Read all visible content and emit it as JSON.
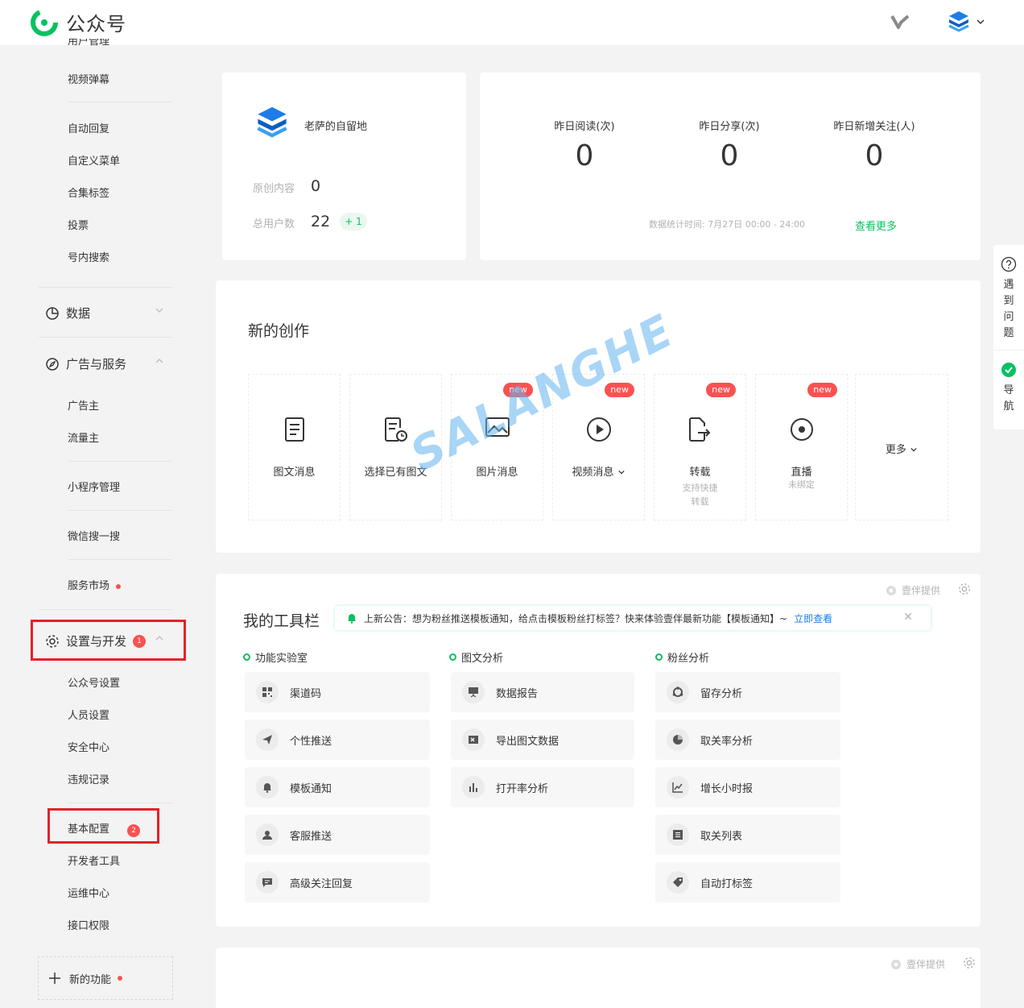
{
  "header": {
    "title": "公众号",
    "brand_color": "#07c160"
  },
  "sidebar": {
    "top_cut_item": "用户管理",
    "items_a": [
      "视频弹幕"
    ],
    "items_b": [
      "自动回复",
      "自定义菜单",
      "合集标签",
      "投票",
      "号内搜索"
    ],
    "group_data": "数据",
    "group_ads": "广告与服务",
    "ads_items": [
      "广告主",
      "流量主"
    ],
    "mini_program": "小程序管理",
    "wechat_search": "微信搜一搜",
    "service_market": "服务市场",
    "group_settings": "设置与开发",
    "settings_badge": "1",
    "settings_items": [
      "公众号设置",
      "人员设置",
      "安全中心",
      "违规记录"
    ],
    "basic_config": "基本配置",
    "basic_badge": "2",
    "dev_items": [
      "开发者工具",
      "运维中心",
      "接口权限"
    ],
    "new_features": "新的功能"
  },
  "account": {
    "name": "老萨的自留地",
    "original_label": "原创内容",
    "original_value": "0",
    "users_label": "总用户数",
    "users_value": "22",
    "users_delta": "+ 1"
  },
  "stats": {
    "items": [
      {
        "label": "昨日阅读(次)",
        "value": "0"
      },
      {
        "label": "昨日分享(次)",
        "value": "0"
      },
      {
        "label": "昨日新增关注(人)",
        "value": "0"
      }
    ],
    "footer": "数据统计时间: 7月27日 00:00 - 24:00",
    "more": "查看更多"
  },
  "creation": {
    "title": "新的创作",
    "new_tag": "new",
    "tiles": [
      {
        "label": "图文消息",
        "sub": "",
        "icon": "doc-icon"
      },
      {
        "label": "选择已有图文",
        "sub": "",
        "icon": "doc-clock-icon"
      },
      {
        "label": "图片消息",
        "sub": "",
        "icon": "image-icon"
      },
      {
        "label": "视频消息",
        "sub": "",
        "icon": "play-icon"
      },
      {
        "label": "转载",
        "sub": "支持快捷转载",
        "icon": "share-doc-icon"
      },
      {
        "label": "直播",
        "sub": "未绑定",
        "icon": "live-icon"
      }
    ],
    "more": "更多"
  },
  "watermark": "SALANGHE",
  "toolbar": {
    "title": "我的工具栏",
    "provider": "壹伴提供",
    "notice": "上新公告：想为粉丝推送模板通知，给点击模板粉丝打标签？快来体验壹伴最新功能【模板通知】~",
    "notice_link": "立即查看",
    "columns": [
      {
        "title": "功能实验室",
        "tools": [
          "渠道码",
          "个性推送",
          "模板通知",
          "客服推送",
          "高级关注回复"
        ]
      },
      {
        "title": "图文分析",
        "tools": [
          "数据报告",
          "导出图文数据",
          "打开率分析"
        ]
      },
      {
        "title": "粉丝分析",
        "tools": [
          "留存分析",
          "取关率分析",
          "增长小时报",
          "取关列表",
          "自动打标签"
        ]
      }
    ]
  },
  "bottom_card": {
    "provider": "壹伴提供"
  },
  "help": {
    "question": "遇到问题",
    "nav": "导航"
  }
}
